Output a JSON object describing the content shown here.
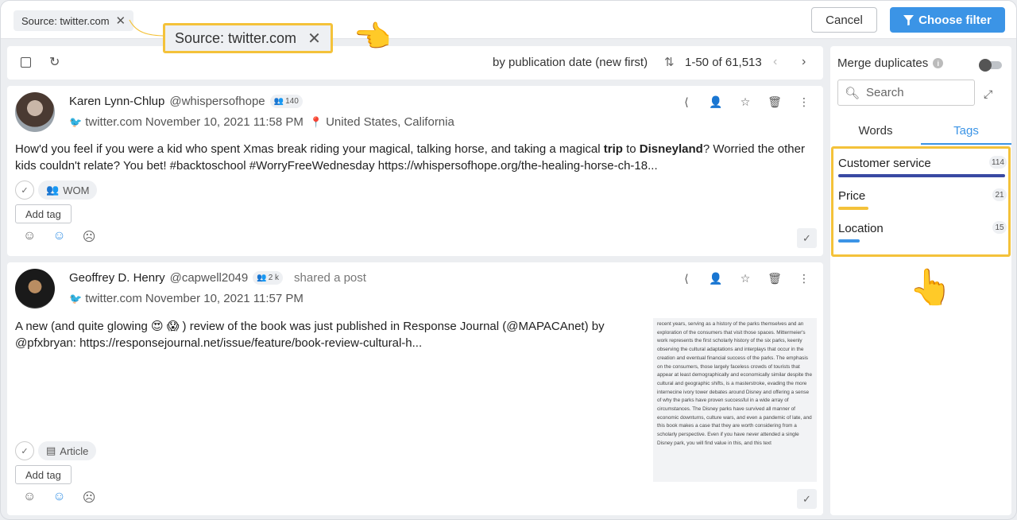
{
  "filter_chip": {
    "label": "Source: twitter.com",
    "close": "✕"
  },
  "header": {
    "cancel_label": "Cancel",
    "choose_filter_label": "Choose filter",
    "filter_icon": "funnel-icon"
  },
  "toolbar": {
    "sort_label": "by publication date (new first)",
    "range_label": "1-50 of 61,513"
  },
  "posts": [
    {
      "author": "Karen Lynn-Chlup",
      "handle": "@whispersofhope",
      "followers": "140",
      "source": "twitter.com",
      "date": "November 10, 2021 11:58 PM",
      "location": "United States, California",
      "text_parts": [
        "How'd you feel if you were a kid who spent Xmas break riding your magical, talking horse, and taking a magical ",
        "trip",
        " to ",
        "Disneyland",
        "? Worried the other kids couldn't relate? You bet! #backtoschool #WorryFreeWednesday https://whispersofhope.org/the-healing-horse-ch-18..."
      ],
      "type": "WOM",
      "add_tag_label": "Add tag"
    },
    {
      "author": "Geoffrey D. Henry",
      "handle": "@capwell2049",
      "followers": "2 k",
      "shared": "shared a post",
      "source": "twitter.com",
      "date": "November 10, 2021 11:57 PM",
      "text": "A new (and quite glowing 😍 😱 ) review of the book was just published in Response Journal (@MAPACAnet) by @pfxbryan: https://responsejournal.net/issue/feature/book-review-cultural-h...",
      "type": "Article",
      "add_tag_label": "Add tag",
      "preview_text": "recent years, serving as a history of the parks themselves and an exploration of the consumers that visit those spaces. Mittermeier's work represents the first scholarly history of the six parks, keenly observing the cultural adaptations and interplays that occur in the creation and eventual financial success of the parks. The emphasis on the consumers, those largely faceless crowds of tourists that appear at least demographically and economically similar despite the cultural and geographic shifts, is a masterstroke, evading the more internecine ivory tower debates around Disney and offering a sense of why the parks have proven successful in a wide array of circumstances. The Disney parks have survived all manner of economic downturns, culture wars, and even a pandemic of late, and this book makes a case that they are worth considering from a scholarly perspective. Even if you have never attended a single Disney park, you will find value in this, and this text"
    }
  ],
  "sidebar": {
    "merge_label": "Merge duplicates",
    "search_placeholder": "Search",
    "tabs": [
      "Words",
      "Tags"
    ],
    "tags": [
      {
        "name": "Customer service",
        "count": "114",
        "color": "#3949a3",
        "share": 1.0
      },
      {
        "name": "Price",
        "count": "21",
        "color": "#f4c23a",
        "share": 0.18
      },
      {
        "name": "Location",
        "count": "15",
        "color": "#3b94e6",
        "share": 0.13
      }
    ]
  }
}
